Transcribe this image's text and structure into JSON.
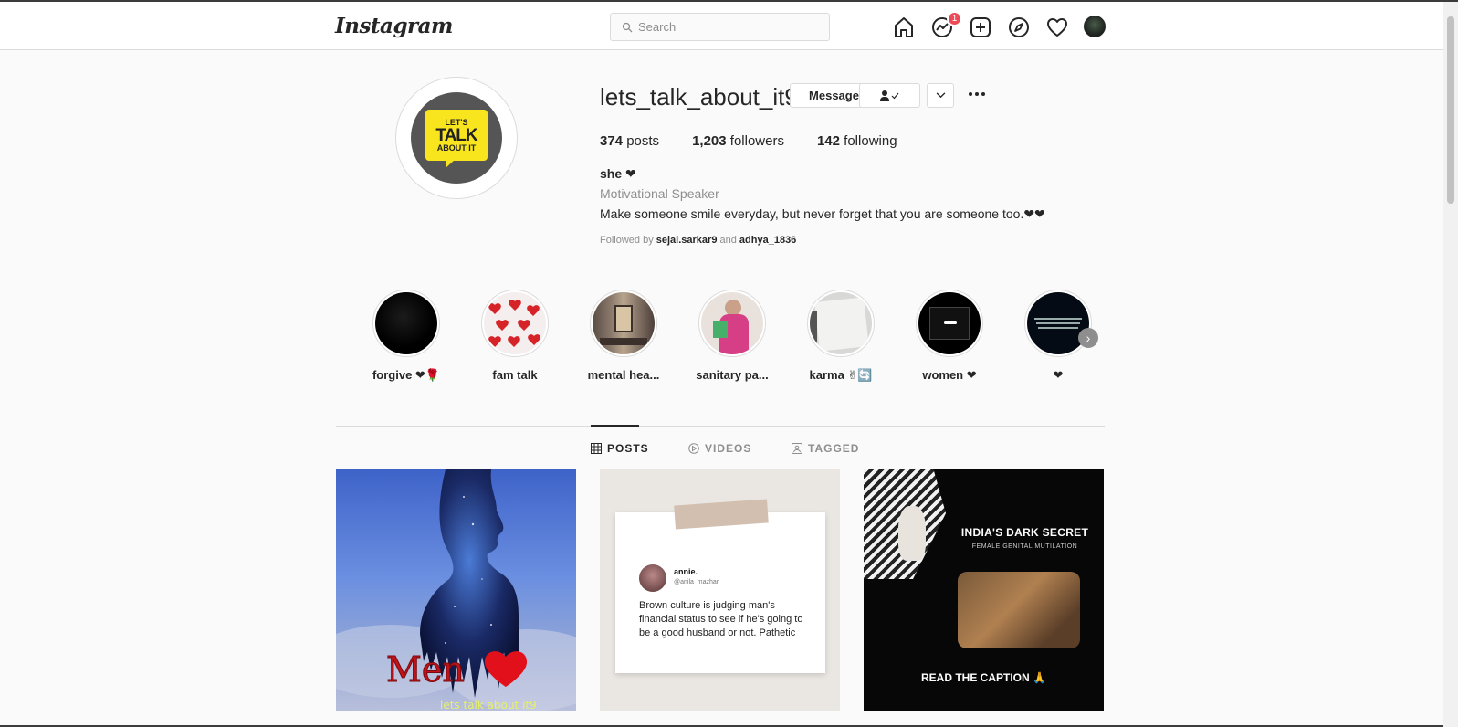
{
  "nav": {
    "logo": "Instagram",
    "search_placeholder": "Search",
    "messenger_badge": "1"
  },
  "profile": {
    "username": "lets_talk_about_it9",
    "message_button": "Message",
    "logo_text": [
      "LET'S",
      "TALK",
      "ABOUT IT"
    ],
    "stats": {
      "posts_count": "374",
      "posts_label": "posts",
      "followers_count": "1,203",
      "followers_label": "followers",
      "following_count": "142",
      "following_label": "following"
    },
    "bio_name": "she ❤",
    "category": "Motivational Speaker",
    "bio_text": "Make someone smile everyday, but never forget that you are someone too.❤❤",
    "followed_by_prefix": "Followed by",
    "followed_by_user1": "sejal.sarkar9",
    "followed_by_and": "and",
    "followed_by_user2": "adhya_1836"
  },
  "highlights": [
    {
      "label": "forgive ❤🌹"
    },
    {
      "label": "fam talk"
    },
    {
      "label": "mental hea..."
    },
    {
      "label": "sanitary pa..."
    },
    {
      "label": "karma ✌🔄"
    },
    {
      "label": "women ❤"
    },
    {
      "label": "❤"
    }
  ],
  "tabs": [
    {
      "label": "POSTS",
      "active": true
    },
    {
      "label": "VIDEOS",
      "active": false
    },
    {
      "label": "TAGGED",
      "active": false
    }
  ],
  "posts": {
    "post1": {
      "title": "Men",
      "watermark": "lets talk about it9"
    },
    "post2": {
      "name": "annie.",
      "handle": "@anila_mazhar",
      "text": "Brown culture is judging man's financial status to see if he's going to be a good husband or not. Pathetic"
    },
    "post3": {
      "title": "INDIA'S DARK SECRET",
      "subtitle": "FEMALE GENITAL MUTILATION",
      "footer": "READ THE CAPTION 🙏"
    }
  },
  "colors": {
    "badge": "#ed4956",
    "logo_yellow": "#f8e51d",
    "text_primary": "#262626",
    "text_secondary": "#8e8e8e"
  }
}
